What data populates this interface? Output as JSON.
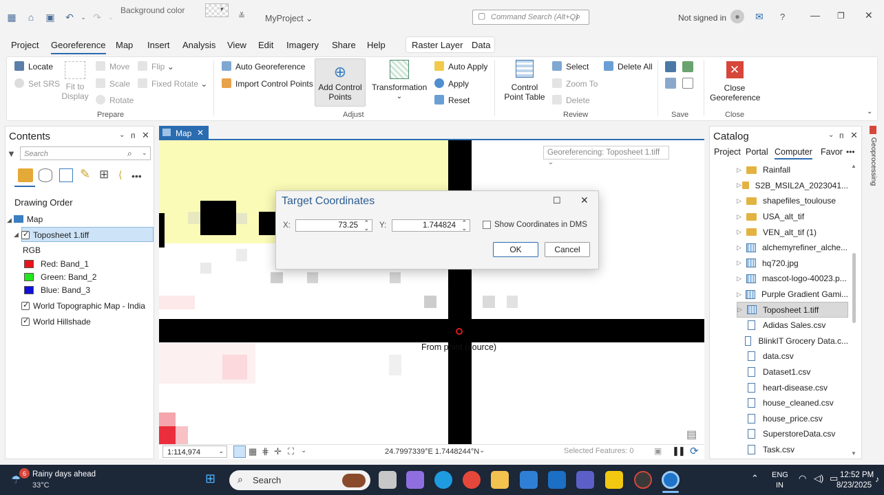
{
  "titlebar": {
    "background_color_label": "Background color",
    "project_name": "MyProject",
    "command_search_placeholder": "Command Search (Alt+Q)",
    "sign_in_status": "Not signed in",
    "help_glyph": "?"
  },
  "menu": {
    "tabs": [
      "Project",
      "Georeference",
      "Map",
      "Insert",
      "Analysis",
      "View",
      "Edit",
      "Imagery",
      "Share",
      "Help"
    ],
    "active_tab": "Georeference",
    "context_tabs": [
      "Raster Layer",
      "Data"
    ]
  },
  "ribbon": {
    "prepare": {
      "locate": "Locate",
      "set_srs": "Set SRS",
      "fit_to_display": [
        "Fit to",
        "Display"
      ],
      "move": "Move",
      "scale": "Scale",
      "rotate": "Rotate",
      "flip": "Flip",
      "fixed_rotate": "Fixed Rotate",
      "group_label": "Prepare"
    },
    "adjust": {
      "auto_georeference": "Auto Georeference",
      "import_control_points": "Import Control Points",
      "add_control_points": [
        "Add Control",
        "Points"
      ],
      "transformation": "Transformation",
      "auto_apply": "Auto Apply",
      "apply": "Apply",
      "reset": "Reset",
      "group_label": "Adjust"
    },
    "review": {
      "control_point_table": [
        "Control",
        "Point Table"
      ],
      "select": "Select",
      "zoom_to": "Zoom To",
      "delete": "Delete",
      "delete_all": "Delete All",
      "group_label": "Review"
    },
    "save": {
      "group_label": "Save"
    },
    "close": {
      "close_georeference": [
        "Close",
        "Georeference"
      ],
      "group_label": "Close"
    }
  },
  "contents": {
    "title": "Contents",
    "search_placeholder": "Search",
    "drawing_order": "Drawing Order",
    "map_label": "Map",
    "layers": {
      "toposheet": "Toposheet 1.tiff",
      "rgb": "RGB",
      "red": "Red:   Band_1",
      "green": "Green: Band_2",
      "blue": "Blue:  Band_3",
      "topo_map": "World Topographic Map - India",
      "hillshade": "World Hillshade"
    },
    "colors": {
      "red": "#e8141c",
      "green": "#22e61e",
      "blue": "#1010d8"
    }
  },
  "mapview": {
    "tab_label": "Map",
    "georef_dropdown": "Georeferencing: Toposheet 1.tiff",
    "from_point_label": "From point (source)",
    "scale": "1:114,974",
    "coordinates": "24.7997339°E 1.7448244°N",
    "selected_features": "Selected Features: 0"
  },
  "dialog": {
    "title": "Target Coordinates",
    "x_label": "X:",
    "x_value": "73.25",
    "y_label": "Y:",
    "y_value": "1.744824",
    "dms_label": "Show Coordinates in DMS",
    "ok": "OK",
    "cancel": "Cancel"
  },
  "catalog": {
    "title": "Catalog",
    "tabs": [
      "Project",
      "Portal",
      "Computer",
      "Favor"
    ],
    "active_tab": "Computer",
    "items": [
      {
        "name": "Rainfall",
        "kind": "folder"
      },
      {
        "name": "S2B_MSIL2A_2023041...",
        "kind": "folder"
      },
      {
        "name": "shapefiles_toulouse",
        "kind": "folder"
      },
      {
        "name": "USA_alt_tif",
        "kind": "folder"
      },
      {
        "name": "VEN_alt_tif (1)",
        "kind": "folder"
      },
      {
        "name": "alchemyrefiner_alche...",
        "kind": "raster"
      },
      {
        "name": "hq720.jpg",
        "kind": "raster"
      },
      {
        "name": "mascot-logo-40023.p...",
        "kind": "raster"
      },
      {
        "name": "Purple Gradient Gami...",
        "kind": "raster"
      },
      {
        "name": "Toposheet 1.tiff",
        "kind": "raster",
        "selected": true
      },
      {
        "name": "Adidas Sales.csv",
        "kind": "file"
      },
      {
        "name": "BlinkIT Grocery Data.c...",
        "kind": "file"
      },
      {
        "name": "data.csv",
        "kind": "file"
      },
      {
        "name": "Dataset1.csv",
        "kind": "file"
      },
      {
        "name": "heart-disease.csv",
        "kind": "file"
      },
      {
        "name": "house_cleaned.csv",
        "kind": "file"
      },
      {
        "name": "house_price.csv",
        "kind": "file"
      },
      {
        "name": "SuperstoreData.csv",
        "kind": "file"
      },
      {
        "name": "Task.csv",
        "kind": "file"
      }
    ]
  },
  "geoprocessing_tab": "Geoprocessing",
  "taskbar": {
    "weather_badge": "6",
    "weather_title": "Rainy days ahead",
    "weather_temp": "33°C",
    "search_label": "Search",
    "lang": "ENG",
    "region": "IN",
    "time": "12:52 PM",
    "date": "8/23/2025"
  }
}
